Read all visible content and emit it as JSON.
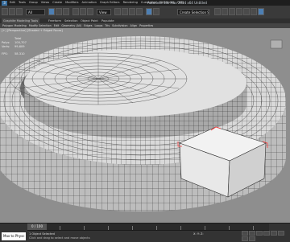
{
  "app": {
    "title": "Autodesk 3ds Max 2014 x64   Untitled",
    "logo": "3"
  },
  "menu": [
    "Edit",
    "Tools",
    "Group",
    "Views",
    "Create",
    "Modifiers",
    "Animation",
    "Graph Editors",
    "Rendering",
    "Customize",
    "MAXScript",
    "Help"
  ],
  "toolbar": {
    "selection_set": "All",
    "view_mode": "View",
    "named_selection": "Create Selection Se"
  },
  "ribbon": {
    "tabs": [
      "Graphite Modeling Tools",
      "Freeform",
      "Selection",
      "Object Paint",
      "Populate"
    ],
    "active_tab": "Graphite Modeling Tools",
    "panels": [
      "Polygon Modeling",
      "Modify Selection",
      "Edit",
      "Geometry (All)",
      "Edges",
      "Loops",
      "Tris",
      "Subdivision",
      "Align",
      "Properties"
    ]
  },
  "viewport": {
    "label": "[+] [Perspective] [Shaded + Edged Faces]",
    "stats_title": "Total",
    "stats": [
      {
        "k": "Polys:",
        "v": "100,707"
      },
      {
        "k": "Verts:",
        "v": "99,609"
      }
    ],
    "fps_label": "FPS:",
    "fps": "58.310"
  },
  "status": {
    "time_slider": "0 / 100",
    "maxscript": "Max to Physc",
    "line1": "1 Object Selected",
    "line2": "Click and drag to select and move objects",
    "coords": "X:   Y:   Z:"
  },
  "colors": {
    "viewport_bg": "#8e8e8e",
    "mesh_face": "#d8d8d8",
    "mesh_wire": "#2a2a2a",
    "selection": "#ff4040"
  }
}
